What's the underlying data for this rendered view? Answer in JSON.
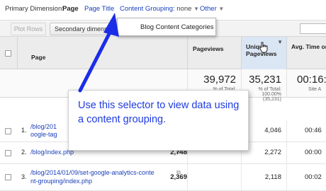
{
  "dimension_bar": {
    "label": "Primary Dimension:",
    "current": "Page",
    "options": [
      "Page Title",
      "Other"
    ],
    "content_grouping_label": "Content Grouping:",
    "content_grouping_value": "none"
  },
  "toolbar": {
    "plot_rows": "Plot Rows",
    "secondary_dimension": "Secondary dimension"
  },
  "dropdown": {
    "items": [
      "Blog Content Categories"
    ]
  },
  "table": {
    "headers": {
      "page": "Page",
      "pageviews": "Pageviews",
      "unique_pageviews": "Unique Pageviews",
      "avg_time": "Avg. Time on"
    },
    "totals": {
      "pageviews": "39,972",
      "pageviews_sub": "% of Total:",
      "unique_pageviews": "35,231",
      "unique_pageviews_sub1": "% of Total:",
      "unique_pageviews_sub2": "100.00%",
      "unique_pageviews_sub3": "(35,231)",
      "avg_time": "00:16:3",
      "avg_time_sub": "Site A"
    },
    "rows": [
      {
        "index": "1.",
        "page_line1": "/blog/201",
        "page_line2": "oogle-tag",
        "pageviews": "",
        "unique_pageviews": "4,046",
        "avg_time": "00:46"
      },
      {
        "index": "2.",
        "page_line1": "/blog/index.php",
        "page_line2": "",
        "pageviews": "2,748",
        "unique_pageviews": "2,272",
        "avg_time": "00:00"
      },
      {
        "index": "3.",
        "page_line1": "/blog/2014/01/09/set-google-analytics-conte",
        "page_line2": "nt-grouping/index.php",
        "pageviews": "2,369",
        "unique_pageviews": "2,118",
        "avg_time": "00:02"
      }
    ]
  },
  "callout": {
    "text": "Use this selector to view data using a content grouping."
  },
  "colors": {
    "link": "#1a3fb8",
    "callout_text": "#1f3be0",
    "arrow": "#1a2ee8",
    "sorted_header": "#dbe6f5"
  },
  "icons": [
    "caret-down-icon",
    "sort-arrow-icon",
    "external-link-icon",
    "hand-cursor-icon",
    "annotation-arrow"
  ]
}
